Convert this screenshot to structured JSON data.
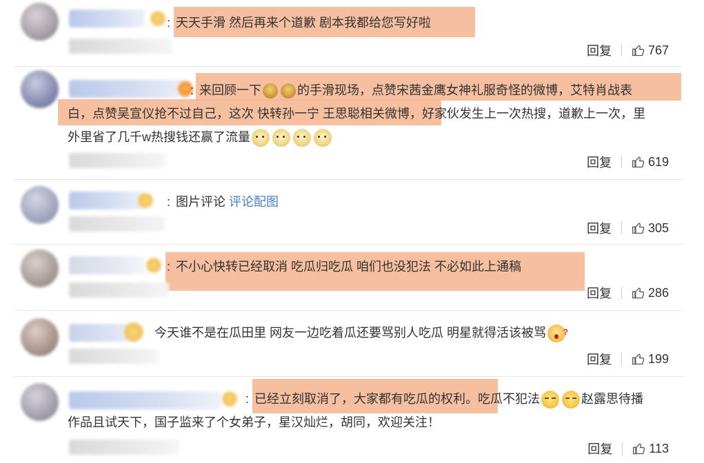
{
  "actions": {
    "reply_label": "回复"
  },
  "comments": [
    {
      "colon": ":",
      "lines": [
        "天天手滑 然后再来个道歉 剧本我都给您写好啦"
      ],
      "likes": "767"
    },
    {
      "colon": ":",
      "line1_a": "来回顾一下",
      "line1_b": "的手滑现场，点赞宋茜金鹰女神礼服奇怪的微博，艾特肖战表",
      "line2": "白，点赞吴宣仪抢不过自己，这次 快转孙一宁 王思聪相关微博，好家伙发生上一次热搜，道歉上一次，里",
      "line3": "外里省了几千w热搜钱还赢了流量",
      "likes": "619",
      "emojis": [
        "burger-icon",
        "dog-face-icon"
      ]
    },
    {
      "colon": ":",
      "text": "图片评论",
      "link": "评论配图",
      "likes": "305"
    },
    {
      "colon": ":",
      "text": "不小心快转已经取消 吃瓜归吃瓜 咱们也没犯法 不必如此上通稿",
      "likes": "286"
    },
    {
      "text": "今天谁不是在瓜田里 网友一边吃着瓜还要骂别人吃瓜 明星就得活该被骂",
      "likes": "199",
      "emoji": "shocked-face-icon"
    },
    {
      "colon": ":",
      "line1_a": "已经立刻取消了，大家都有吃瓜的权利。吃瓜不犯法",
      "line1_b": "赵露思待播",
      "line2": "作品且试天下，国子监来了个女弟子，星汉灿烂，胡同，欢迎关注！",
      "likes": "113",
      "emoji": "smug-face-icon"
    }
  ],
  "colors": {
    "highlight": "#f5b48e",
    "link": "#4a7fc8",
    "divider": "#e6e6e6"
  }
}
